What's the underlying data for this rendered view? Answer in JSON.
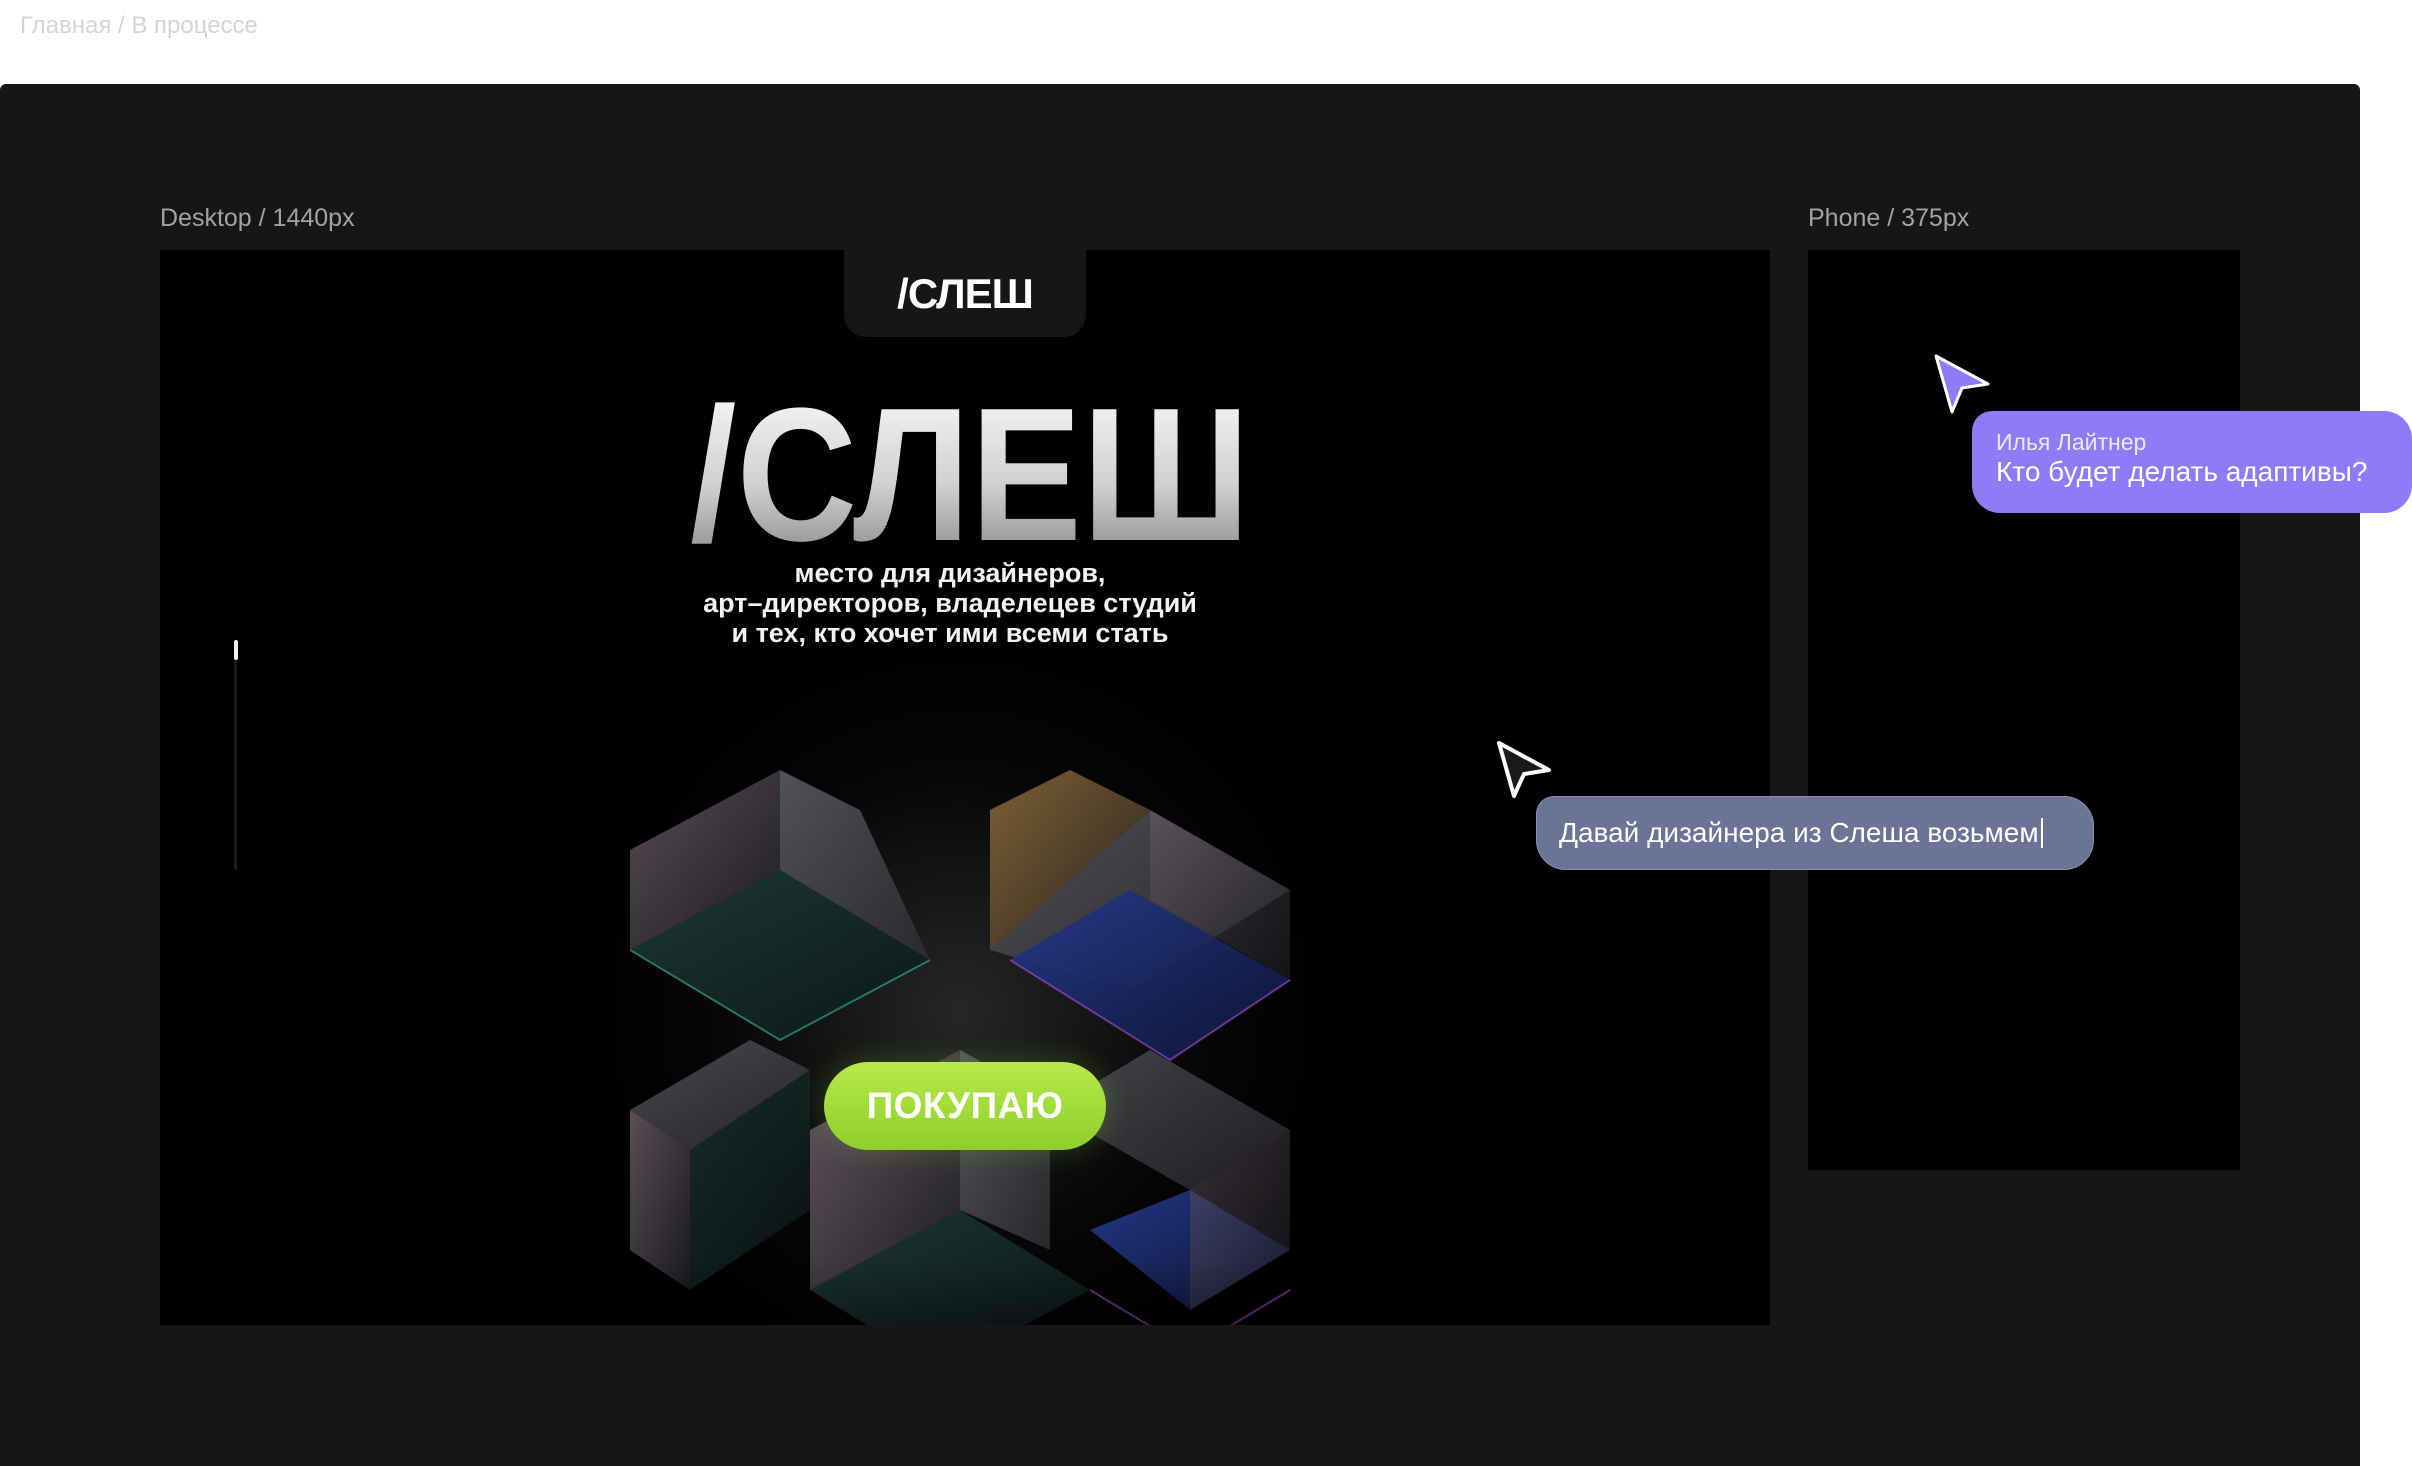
{
  "breadcrumb": "Главная / В процессе",
  "frames": {
    "desktop_label": "Desktop / 1440px",
    "phone_label": "Phone / 375px"
  },
  "site": {
    "nav_logo": "/СЛЕШ",
    "hero_logo": "/СЛЕШ",
    "tagline": [
      "место для дизайнеров,",
      "арт–директоров, владелецев студий",
      "и тех, кто хочет ими всеми стать"
    ],
    "buy_button": "ПОКУПАЮ",
    "scroll_progress": 0.08
  },
  "collaboration": {
    "comment": {
      "author": "Илья Лайтнер",
      "text": "Кто будет делать адаптивы?",
      "color": "#8d7cf5"
    },
    "input": {
      "value": "Давай дизайнера из Слеша возьмем",
      "color": "#6b7397"
    }
  },
  "colors": {
    "canvas": "#161616",
    "frame": "#000000",
    "accent_green": "#a3dc3a",
    "accent_purple": "#8d7cf5"
  }
}
